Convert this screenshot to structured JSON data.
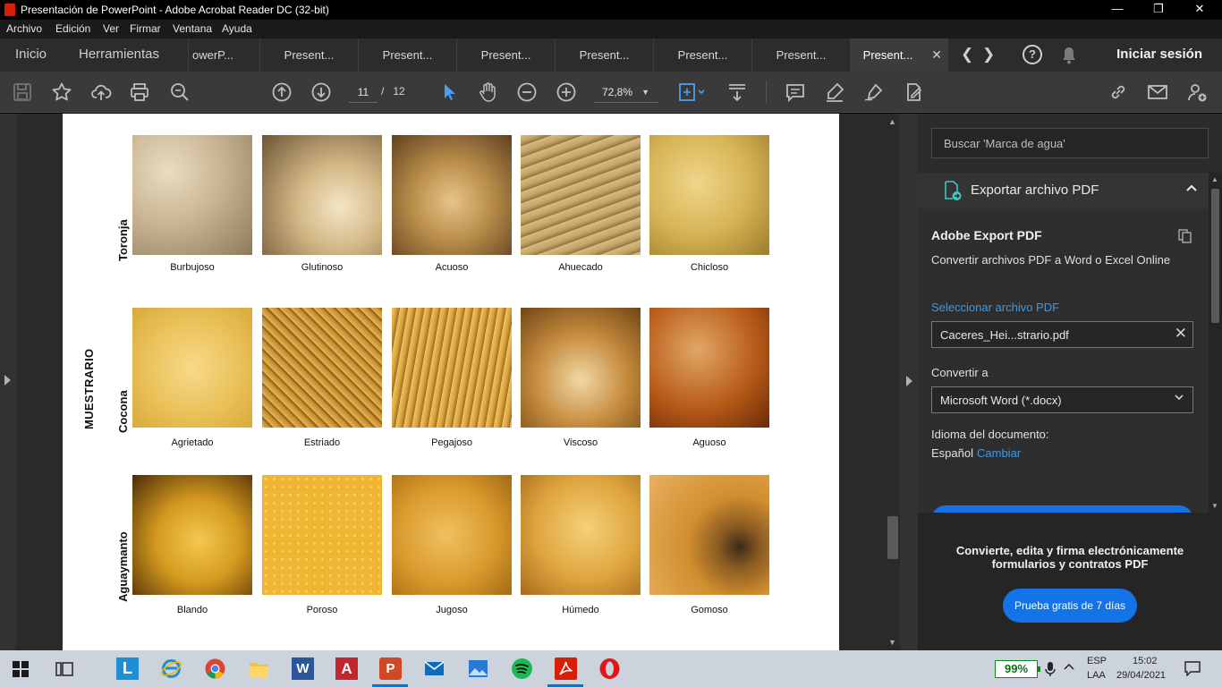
{
  "window": {
    "title": "Presentación de PowerPoint - Adobe Acrobat Reader DC (32-bit)",
    "controls": {
      "minimize": "—",
      "restore": "❐",
      "close": "✕"
    }
  },
  "menu": [
    "Archivo",
    "Edición",
    "Ver",
    "Firmar",
    "Ventana",
    "Ayuda"
  ],
  "tabbar": {
    "home": "Inicio",
    "tools": "Herramientas",
    "doc_tabs": [
      "owerP...",
      "Present...",
      "Present...",
      "Present...",
      "Present...",
      "Present...",
      "Present...",
      "Present..."
    ],
    "active_tab_index": 7,
    "close_glyph": "✕",
    "prev": "❮",
    "next": "❯",
    "help": "?",
    "signin": "Iniciar sesión"
  },
  "toolbar": {
    "current_page": "11",
    "page_separator": "/",
    "total_pages": "12",
    "zoom": "72,8%",
    "zoom_caret": "▼"
  },
  "document": {
    "side_title": "MUESTRARIO",
    "rows": [
      {
        "label": "Toronja",
        "items": [
          {
            "caption": "Burbujoso",
            "color": "#c9b593"
          },
          {
            "caption": "Glutinoso",
            "color": "#d3b886"
          },
          {
            "caption": "Acuoso",
            "color": "#b88d4a"
          },
          {
            "caption": "Ahuecado",
            "color": "#c4a366"
          },
          {
            "caption": "Chicloso",
            "color": "#d7b556"
          }
        ]
      },
      {
        "label": "Cocona",
        "items": [
          {
            "caption": "Agrietado",
            "color": "#eac25a"
          },
          {
            "caption": "Estriado",
            "color": "#c78f2c"
          },
          {
            "caption": "Pegajoso",
            "color": "#d9a23e"
          },
          {
            "caption": "Viscoso",
            "color": "#c48a3c"
          },
          {
            "caption": "Aguoso",
            "color": "#b95b19"
          }
        ]
      },
      {
        "label": "Aguaymanto",
        "items": [
          {
            "caption": "Blando",
            "color": "#d49a1e"
          },
          {
            "caption": "Poroso",
            "color": "#efb634"
          },
          {
            "caption": "Jugoso",
            "color": "#d99a2c"
          },
          {
            "caption": "Húmedo",
            "color": "#dfa43c"
          },
          {
            "caption": "Gomoso",
            "color": "#d18f2e"
          }
        ]
      }
    ]
  },
  "panel": {
    "search_placeholder": "Buscar 'Marca de agua'",
    "section_title": "Exportar archivo PDF",
    "collapse_glyph": "⌃",
    "service_title": "Adobe Export PDF",
    "service_desc": "Convertir archivos PDF a Word o Excel Online",
    "select_file_link": "Seleccionar archivo PDF",
    "selected_file": "Caceres_Hei...strario.pdf",
    "clear_glyph": "✕",
    "convert_to_label": "Convertir a",
    "convert_to_value": "Microsoft Word (*.docx)",
    "select_chevron": "⌄",
    "language_label": "Idioma del documento:",
    "language_value": "Español",
    "language_change": "Cambiar",
    "promo_text": "Convierte, edita y firma electrónicamente formularios y contratos PDF",
    "promo_button": "Prueba gratis de 7 días"
  },
  "taskbar": {
    "battery": "99%",
    "lang_top": "ESP",
    "lang_bottom": "LAA",
    "time": "15:02",
    "date": "29/04/2021"
  }
}
